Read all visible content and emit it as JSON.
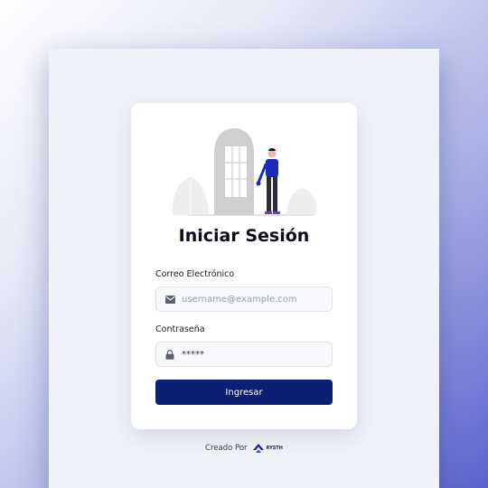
{
  "login": {
    "title": "Iniciar Sesión",
    "email_label": "Correo Electrónico",
    "email_placeholder": "username@example.com",
    "email_icon": "envelope-icon",
    "password_label": "Contraseña",
    "password_value": "*****",
    "password_icon": "lock-icon",
    "submit_label": "Ingresar"
  },
  "footer": {
    "created_by": "Creado Por",
    "brand": "RYSTH"
  },
  "colors": {
    "primary": "#0d1f73",
    "card": "#ffffff",
    "panel": "#eff2f8",
    "figure_shirt": "#1d2ab8"
  }
}
